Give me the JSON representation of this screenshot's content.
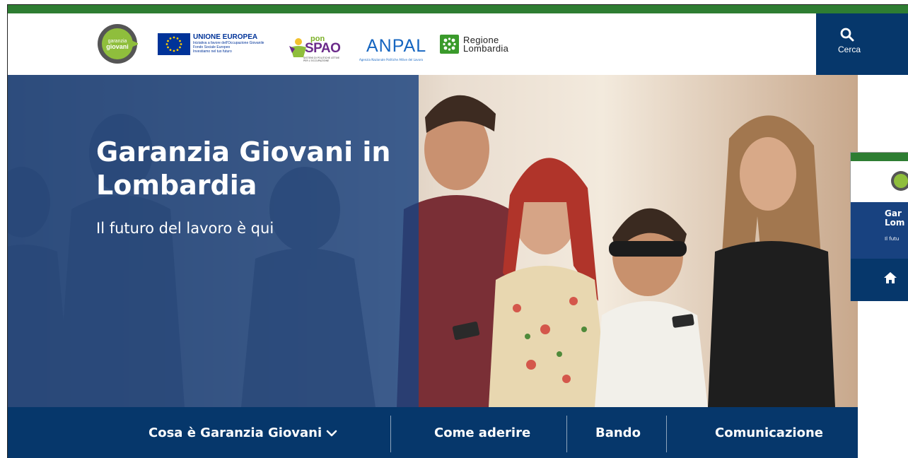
{
  "header": {
    "logo_garanzia": {
      "line1": "garanzia",
      "line2": "giovani"
    },
    "logo_eu": {
      "title": "UNIONE EUROPEA",
      "line1": "Iniziativa a favore dell'Occupazione Giovanile",
      "line2": "Fondo Sociale Europeo",
      "line3": "Investiamo nel tuo futuro"
    },
    "logo_pon": {
      "small": "pon",
      "big": "SPAO",
      "tiny": "SISTEMI DI POLITICHE ATTIVE PER L'OCCUPAZIONE"
    },
    "logo_anpal": {
      "word": "ANPAL",
      "sub": "Agenzia Nazionale Politiche Attive del Lavoro"
    },
    "logo_regione": {
      "line1": "Regione",
      "line2": "Lombardia"
    },
    "search": {
      "label": "Cerca",
      "icon": "search-icon"
    }
  },
  "hero": {
    "title": "Garanzia Giovani in Lombardia",
    "subtitle": "Il futuro del lavoro è qui"
  },
  "nav": {
    "items": [
      {
        "label": "Cosa è Garanzia Giovani",
        "has_dropdown": true
      },
      {
        "label": "Come aderire"
      },
      {
        "label": "Bando"
      },
      {
        "label": "Comunicazione"
      }
    ]
  },
  "thumbnail": {
    "title": "Gar\nLom",
    "subtitle": "Il futu",
    "home_icon": "home-icon"
  },
  "colors": {
    "green_bar": "#2e7d32",
    "navy": "#06376b",
    "overlay_blue": "#184280",
    "white": "#ffffff"
  }
}
